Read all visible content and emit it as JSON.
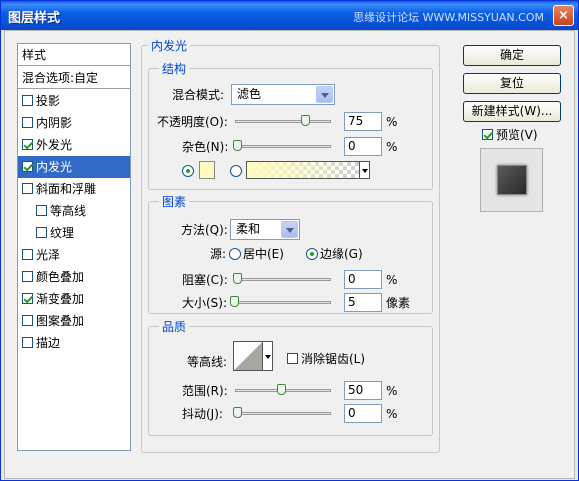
{
  "window": {
    "title": "图层样式",
    "watermark": "思缘设计论坛 WWW.MISSYUAN.COM",
    "close_glyph": "×"
  },
  "style_list": {
    "header": "样式",
    "blend_options": "混合选项:自定",
    "items": [
      {
        "label": "投影",
        "checked": false,
        "indent": false
      },
      {
        "label": "内阴影",
        "checked": false,
        "indent": false
      },
      {
        "label": "外发光",
        "checked": true,
        "indent": false
      },
      {
        "label": "内发光",
        "checked": true,
        "indent": false,
        "selected": true
      },
      {
        "label": "斜面和浮雕",
        "checked": false,
        "indent": false
      },
      {
        "label": "等高线",
        "checked": false,
        "indent": true
      },
      {
        "label": "纹理",
        "checked": false,
        "indent": true
      },
      {
        "label": "光泽",
        "checked": false,
        "indent": false
      },
      {
        "label": "颜色叠加",
        "checked": false,
        "indent": false
      },
      {
        "label": "渐变叠加",
        "checked": true,
        "indent": false
      },
      {
        "label": "图案叠加",
        "checked": false,
        "indent": false
      },
      {
        "label": "描边",
        "checked": false,
        "indent": false
      }
    ]
  },
  "panel": {
    "title": "内发光",
    "structure": {
      "title": "结构",
      "blend_mode_label": "混合模式:",
      "blend_mode_value": "滤色",
      "opacity_label": "不透明度(O):",
      "opacity_value": "75",
      "opacity_unit": "%",
      "noise_label": "杂色(N):",
      "noise_value": "0",
      "noise_unit": "%",
      "opacity_fraction": 0.75,
      "noise_fraction": 0,
      "color_swatch": "#fffbbf"
    },
    "elements": {
      "title": "图素",
      "technique_label": "方法(Q):",
      "technique_value": "柔和",
      "source_label": "源:",
      "source_center": "居中(E)",
      "source_edge": "边缘(G)",
      "choke_label": "阻塞(C):",
      "choke_value": "0",
      "choke_unit": "%",
      "size_label": "大小(S):",
      "size_value": "5",
      "size_unit": "像素",
      "choke_fraction": 0,
      "size_fraction": 0.02
    },
    "quality": {
      "title": "品质",
      "contour_label": "等高线:",
      "anti_alias_label": "消除锯齿(L)",
      "range_label": "范围(R):",
      "range_value": "50",
      "range_unit": "%",
      "jitter_label": "抖动(J):",
      "jitter_value": "0",
      "jitter_unit": "%",
      "range_fraction": 0.5,
      "jitter_fraction": 0
    }
  },
  "buttons": {
    "ok": "确定",
    "reset": "复位",
    "new_style": "新建样式(W)...",
    "preview": "预览(V)"
  }
}
